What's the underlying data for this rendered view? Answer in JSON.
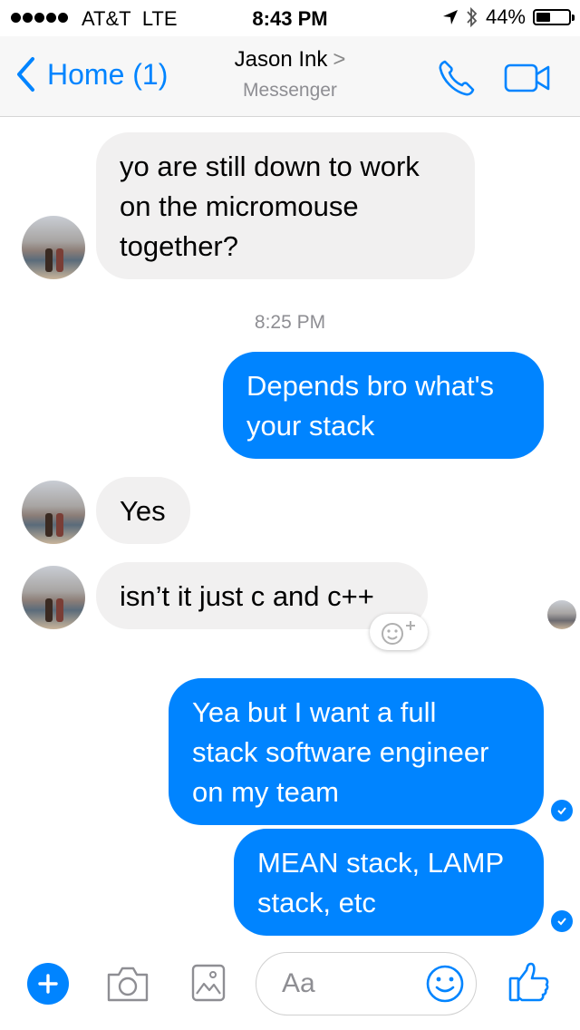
{
  "status_bar": {
    "carrier": "AT&T",
    "network": "LTE",
    "time": "8:43 PM",
    "battery": "44%",
    "battery_level": 0.44,
    "signal_bars": 5,
    "icons": [
      "location-icon",
      "bluetooth-icon",
      "battery-icon"
    ]
  },
  "nav": {
    "back_label": "Home (1)",
    "contact_name": "Jason Ink",
    "contact_chevron": ">",
    "subtitle": "Messenger",
    "icons": [
      "chevron-left-icon",
      "phone-icon",
      "video-camera-icon"
    ]
  },
  "conversation": {
    "timestamp": "8:25 PM",
    "messages": [
      {
        "sender": "contact",
        "text": "yo are still down to work\non the micromouse\ntogether?"
      },
      {
        "sender": "me",
        "text": "Depends bro what's\nyour stack"
      },
      {
        "sender": "contact",
        "text": "Yes"
      },
      {
        "sender": "contact",
        "text": "isn’t it just c and c++"
      },
      {
        "sender": "me",
        "text": "Yea but I want a full\nstack software engineer\non my team"
      },
      {
        "sender": "me",
        "text": "MEAN stack, LAMP\nstack, etc"
      }
    ],
    "reaction_button_icon": "add-reaction-icon",
    "read_receipt_icon": "check-circle-icon"
  },
  "composer": {
    "placeholder": "Aa",
    "icons": [
      "plus-icon",
      "camera-icon",
      "gallery-icon",
      "emoji-icon",
      "thumbs-up-icon"
    ]
  },
  "colors": {
    "accent": "#0084ff",
    "incoming_bubble": "#f1f0f0",
    "secondary_text": "#8e8e93"
  }
}
